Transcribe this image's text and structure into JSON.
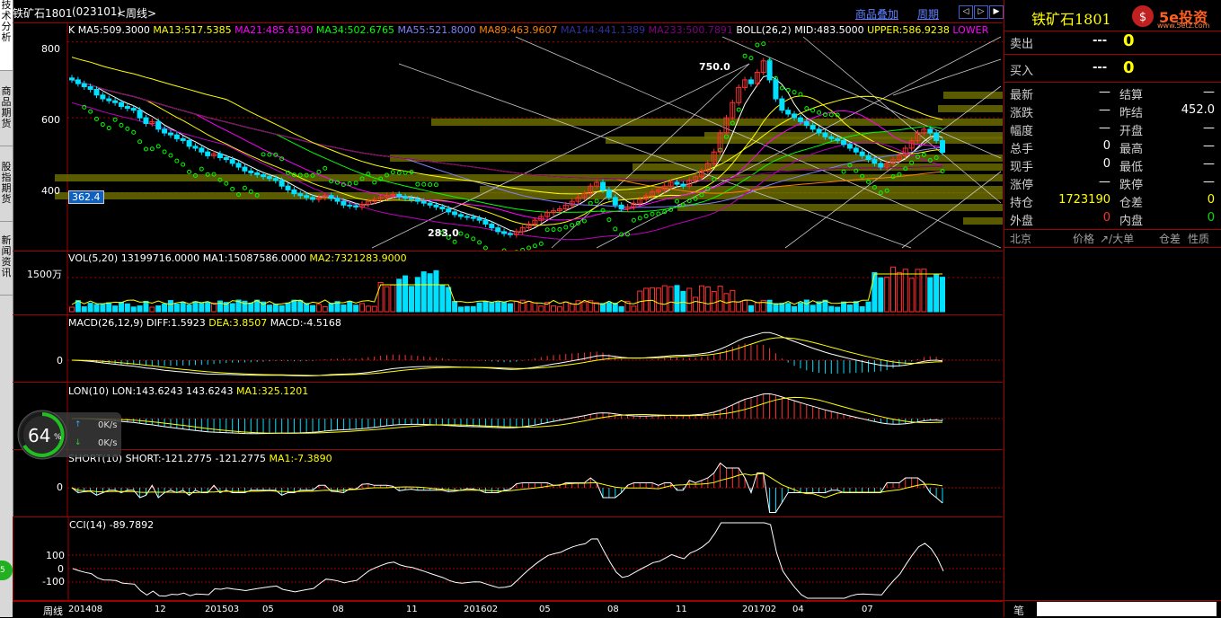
{
  "left_tabs": [
    "技术分析",
    "商品期货",
    "股指期货",
    "新闻资讯"
  ],
  "header": {
    "symbol": "铁矿石1801",
    "code": "(023101)",
    "period": "<周线>",
    "overlay_link": "商品叠加",
    "period_link": "周期"
  },
  "main_panel": {
    "label": "K",
    "indicators": [
      {
        "text": "MA5:509.3000",
        "color": "#ffffff"
      },
      {
        "text": "MA13:517.5385",
        "color": "#ffff00"
      },
      {
        "text": "MA21:485.6190",
        "color": "#ff00ff"
      },
      {
        "text": "MA34:502.6765",
        "color": "#00ff00"
      },
      {
        "text": "MA55:521.8000",
        "color": "#8080ff"
      },
      {
        "text": "MA89:463.9607",
        "color": "#ff8000"
      },
      {
        "text": "MA144:441.1389",
        "color": "#3030a0"
      },
      {
        "text": "MA233:500.7891",
        "color": "#800080"
      },
      {
        "text": "BOLL(26,2)",
        "color": "#ffffff"
      },
      {
        "text": "MID:483.5000",
        "color": "#ffffff"
      },
      {
        "text": "UPPER:586.9238",
        "color": "#ffff00"
      },
      {
        "text": "LOWER",
        "color": "#ff00ff"
      }
    ],
    "y_ticks": [
      "800",
      "600",
      "400"
    ],
    "price_tag": "362.4",
    "high_label": "750.0",
    "low_label": "283.0"
  },
  "vol_panel": {
    "title": "VOL(5,20)",
    "v1": "13199716.0000",
    "ma1": "MA1:15087586.0000",
    "ma2": "MA2:7321283.9000",
    "y_tick": "1500万"
  },
  "macd_panel": {
    "title": "MACD(26,12,9)",
    "diff": "DIFF:1.5923",
    "dea": "DEA:3.8507",
    "macd": "MACD:-4.5168",
    "y_tick": "0"
  },
  "lon_panel": {
    "title": "LON(10)",
    "lon": "LON:143.6243",
    "v2": "143.6243",
    "ma1": "MA1:325.1201"
  },
  "short_panel": {
    "title": "SHORT(10)",
    "short": "SHORT:-121.2775",
    "v2": "-121.2775",
    "ma1": "MA1:-7.3890",
    "y_tick": "0"
  },
  "cci_panel": {
    "title": "CCI(14)",
    "value": "-89.7892",
    "y_ticks": [
      "100",
      "0",
      "-100"
    ]
  },
  "x_axis": {
    "label": "周线",
    "ticks": [
      "201408",
      "12",
      "201503",
      "05",
      "08",
      "11",
      "201602",
      "05",
      "08",
      "11",
      "201702",
      "04",
      "07"
    ]
  },
  "gauge": {
    "percent": "64",
    "unit": "%",
    "up": "0K/s",
    "down": "0K/s"
  },
  "quote": {
    "title": "铁矿石1801",
    "brand": "5e投资",
    "brand_url": "www.5etz.com",
    "sell_label": "卖出",
    "sell_price": "---",
    "sell_vol": "0",
    "buy_label": "买入",
    "buy_price": "---",
    "buy_vol": "0",
    "rows": [
      [
        "最新",
        "—",
        "结算",
        "—"
      ],
      [
        "涨跌",
        "—",
        "昨结",
        "452.0"
      ],
      [
        "幅度",
        "—",
        "开盘",
        "—"
      ],
      [
        "总手",
        "0",
        "最高",
        "—"
      ],
      [
        "现手",
        "0",
        "最低",
        "—"
      ],
      [
        "涨停",
        "—",
        "跌停",
        "—"
      ]
    ],
    "position_label": "持仓",
    "position": "1723190",
    "diff_label": "仓差",
    "diff": "0",
    "outer_label": "外盘",
    "outer": "0",
    "inner_label": "内盘",
    "inner": "0",
    "ticks_header": [
      "北京",
      "价格",
      "↗/大单",
      "仓差",
      "性质"
    ],
    "bottom_label": "笔"
  },
  "chart_data": {
    "type": "candlestick",
    "period": "weekly",
    "weeks": 142,
    "price_range": [
      250,
      830
    ],
    "close": [
      700,
      690,
      682,
      675,
      660,
      650,
      645,
      640,
      630,
      625,
      620,
      600,
      585,
      590,
      570,
      560,
      555,
      545,
      540,
      525,
      520,
      510,
      500,
      505,
      495,
      490,
      480,
      470,
      460,
      455,
      450,
      445,
      440,
      435,
      420,
      410,
      400,
      395,
      390,
      385,
      390,
      395,
      388,
      380,
      370,
      368,
      365,
      372,
      380,
      385,
      390,
      395,
      398,
      392,
      388,
      385,
      380,
      375,
      370,
      365,
      360,
      352,
      345,
      340,
      338,
      335,
      330,
      320,
      310,
      300,
      295,
      292,
      300,
      310,
      320,
      330,
      340,
      350,
      355,
      360,
      370,
      380,
      390,
      400,
      420,
      430,
      410,
      390,
      370,
      360,
      365,
      375,
      385,
      395,
      405,
      410,
      420,
      430,
      425,
      420,
      435,
      445,
      460,
      480,
      510,
      560,
      600,
      640,
      680,
      700,
      690,
      720,
      750,
      700,
      650,
      620,
      610,
      600,
      590,
      580,
      570,
      560,
      550,
      545,
      540,
      530,
      520,
      510,
      500,
      490,
      480,
      470,
      480,
      490,
      500,
      520,
      540,
      560,
      570,
      560,
      540,
      509
    ],
    "volume_high": 15087586,
    "annotations": {
      "high": "750.0",
      "low": "283.0"
    }
  },
  "colors": {
    "up": "#ff3030",
    "down": "#00e0ff",
    "grid": "#a00000",
    "axis": "#a00000",
    "yellow": "#ffff00"
  }
}
